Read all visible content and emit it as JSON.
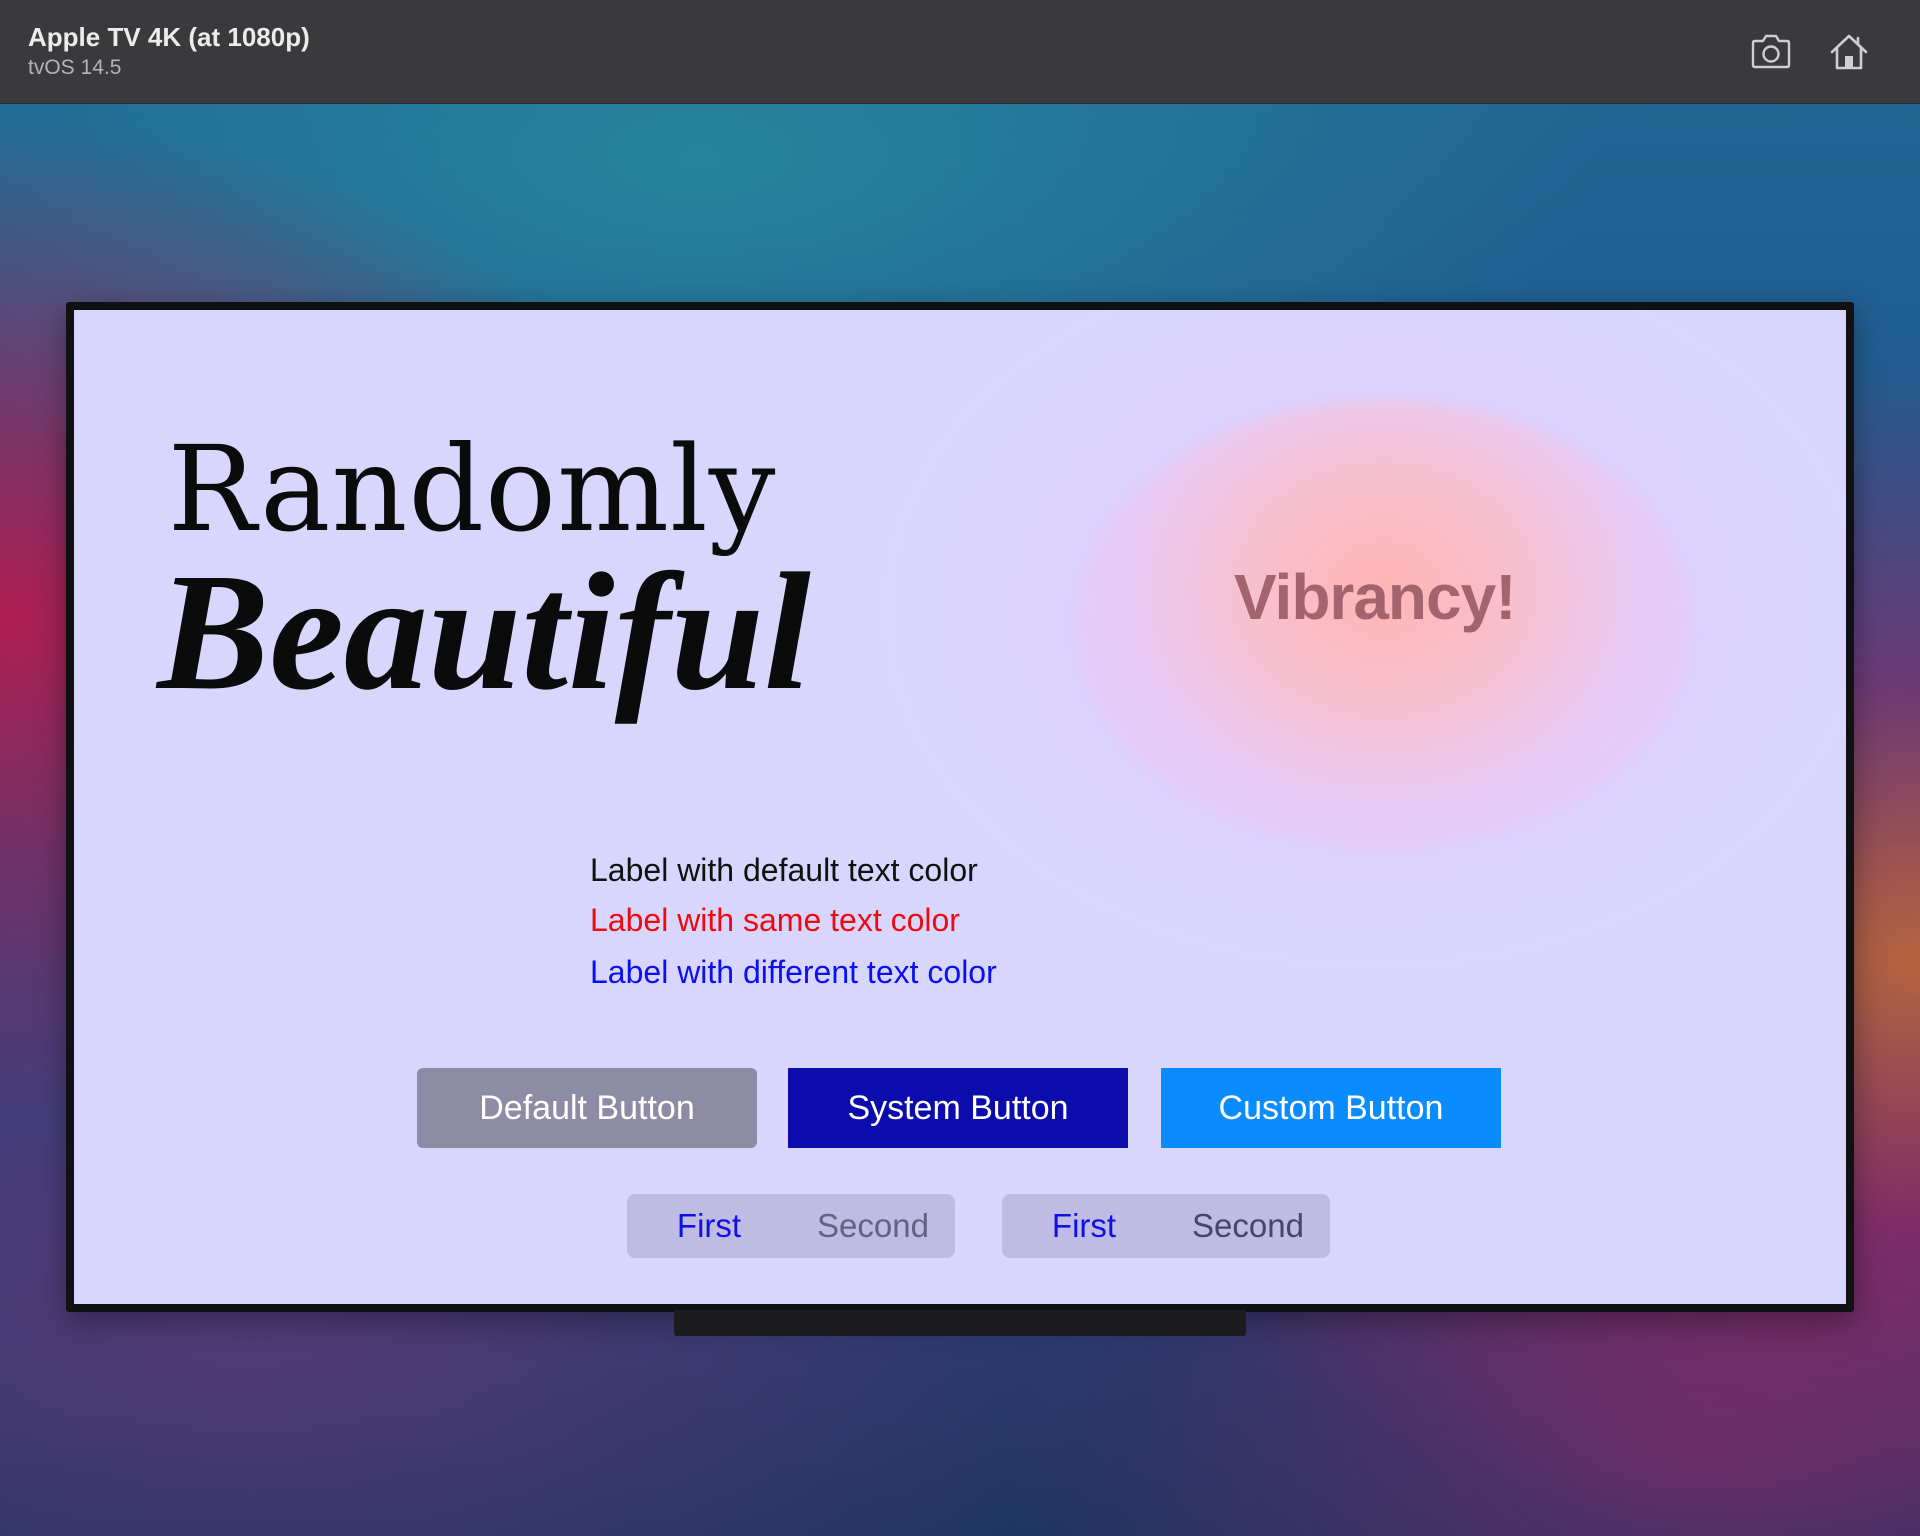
{
  "window": {
    "title": "Apple TV 4K (at 1080p)",
    "subtitle": "tvOS 14.5",
    "toolbar_icons": [
      "screenshot-icon",
      "home-icon"
    ]
  },
  "screen": {
    "hero": {
      "line1": "Randomly",
      "line2": "Beautiful"
    },
    "vibrancy": {
      "text": "Vibrancy!"
    },
    "labels": {
      "default": "Label with default text color",
      "same": "Label with same text color",
      "different": "Label with different text color"
    },
    "buttons": {
      "default": "Default Button",
      "system": "System Button",
      "custom": "Custom Button"
    },
    "segmented_controls": [
      {
        "first": "First",
        "second": "Second",
        "selected": "First"
      },
      {
        "first": "First",
        "second": "Second",
        "selected": "First"
      }
    ]
  },
  "colors": {
    "screen_background": "#d9d6fe",
    "label_default": "#111111",
    "label_same": "#f00a10",
    "label_different": "#0a10f0",
    "default_button": "#8e8ca5",
    "system_button": "#0c0cad",
    "custom_button": "#0a8bfe",
    "vibrancy_text": "#a3646f",
    "segment_selected": "#0f10e6"
  }
}
